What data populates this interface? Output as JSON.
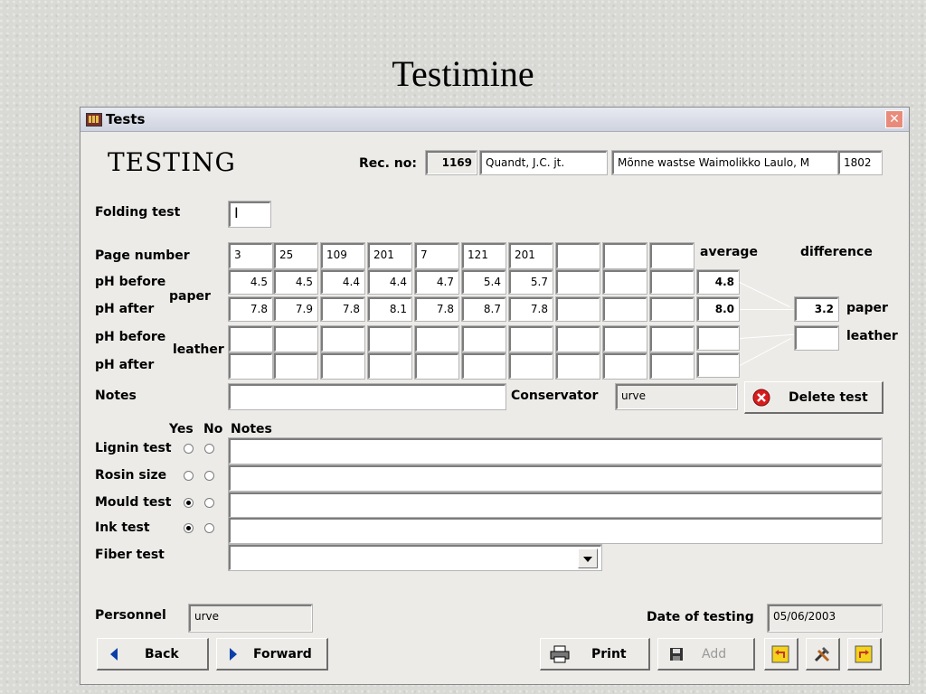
{
  "slide": {
    "title": "Testimine"
  },
  "window": {
    "title": "Tests"
  },
  "form": {
    "heading": "TESTING",
    "rec_no_label": "Rec. no:",
    "rec_no": "1169",
    "author": "Quandt, J.C. jt.",
    "book_title": "Mõnne wastse Waimolikko Laulo, M",
    "year": "1802",
    "folding_test_label": "Folding test",
    "folding_test_value": "I",
    "page_number_label": "Page number",
    "page_numbers": [
      "3",
      "25",
      "109",
      "201",
      "7",
      "121",
      "201",
      "",
      "",
      ""
    ],
    "ph_before_label": "pH before",
    "ph_after_label": "pH after",
    "paper_label": "paper",
    "leather_label": "leather",
    "average_label": "average",
    "difference_label": "difference",
    "ph_before_paper": [
      "4.5",
      "4.5",
      "4.4",
      "4.4",
      "4.7",
      "5.4",
      "5.7",
      "",
      "",
      ""
    ],
    "ph_after_paper": [
      "7.8",
      "7.9",
      "7.8",
      "8.1",
      "7.8",
      "8.7",
      "7.8",
      "",
      "",
      ""
    ],
    "avg_before_paper": "4.8",
    "avg_after_paper": "8.0",
    "diff_paper": "3.2",
    "diff_paper_label": "paper",
    "diff_leather_label": "leather",
    "diff_leather": "",
    "notes_label": "Notes",
    "notes_value": "",
    "conservator_label": "Conservator",
    "conservator_value": "urve",
    "delete_label": "Delete test",
    "yes_label": "Yes",
    "no_label": "No",
    "tests_notes_label": "Notes",
    "tests": [
      {
        "label": "Lignin test",
        "yes": false,
        "no": false,
        "notes": ""
      },
      {
        "label": "Rosin size",
        "yes": false,
        "no": false,
        "notes": ""
      },
      {
        "label": "Mould test",
        "yes": true,
        "no": false,
        "notes": ""
      },
      {
        "label": "Ink test",
        "yes": true,
        "no": false,
        "notes": ""
      }
    ],
    "fiber_test_label": "Fiber test",
    "fiber_test_value": "",
    "personnel_label": "Personnel",
    "personnel_value": "urve",
    "date_label": "Date of testing",
    "date_value": "05/06/2003"
  },
  "buttons": {
    "back": "Back",
    "forward": "Forward",
    "print": "Print",
    "add": "Add"
  },
  "colors": {
    "nav_arrow": "#0b3fa8",
    "delete_icon": "#d91c1c"
  }
}
